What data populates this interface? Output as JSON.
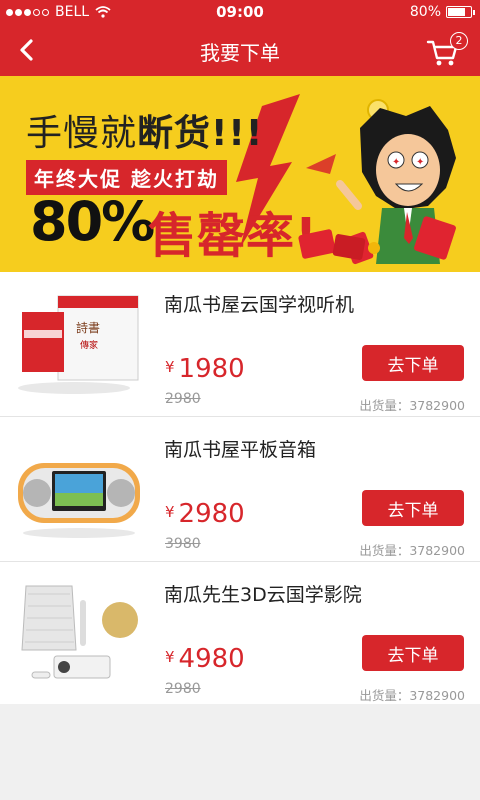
{
  "status_bar": {
    "carrier": "BELL",
    "time": "09:00",
    "battery": "80%",
    "battery_level": 0.8,
    "signal_bars": 3,
    "signal_total": 5
  },
  "nav": {
    "title": "我要下单",
    "cart_count": "2"
  },
  "banner": {
    "line1_prefix": "手慢就",
    "line1_bold": "断货!!!",
    "tag": "年终大促  趁火打劫",
    "percent": "80%",
    "sellout": "售罄率!"
  },
  "products": [
    {
      "name": "南瓜书屋云国学视听机",
      "currency": "¥",
      "price": "1980",
      "old_price": "2980",
      "sales_label": "出货量：",
      "sales": "3782900",
      "button": "去下单"
    },
    {
      "name": "南瓜书屋平板音箱",
      "currency": "¥",
      "price": "2980",
      "old_price": "3980",
      "sales_label": "出货量：",
      "sales": "3782900",
      "button": "去下单"
    },
    {
      "name": "南瓜先生3D云国学影院",
      "currency": "¥",
      "price": "4980",
      "old_price": "2980",
      "sales_label": "出货量：",
      "sales": "3782900",
      "button": "去下单"
    }
  ],
  "colors": {
    "brand_red": "#d7262b",
    "banner_yellow": "#f6cd1e"
  },
  "icons": [
    "back-chevron-icon",
    "cart-icon",
    "wifi-icon",
    "battery-icon"
  ]
}
